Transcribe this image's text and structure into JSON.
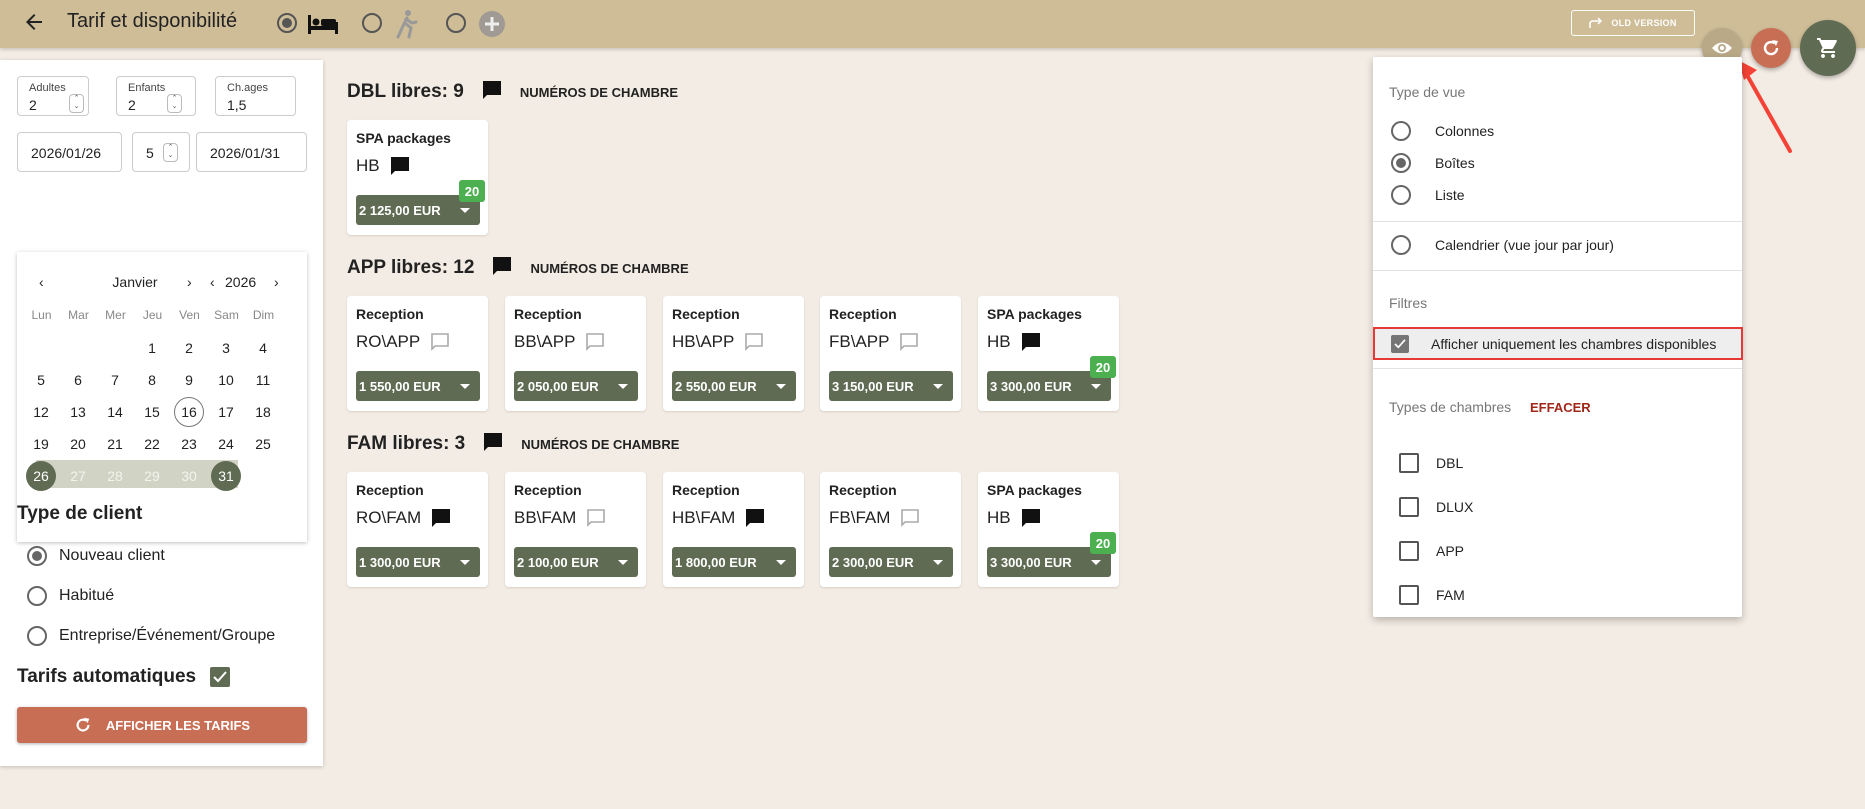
{
  "header": {
    "title": "Tarif et disponibilité",
    "old_version_label": "OLD VERSION",
    "mode_options": [
      {
        "icon": "bed-icon",
        "selected": true
      },
      {
        "icon": "walk-icon",
        "selected": false
      },
      {
        "icon": "plus-icon",
        "selected": false
      }
    ]
  },
  "search": {
    "adults_label": "Adultes",
    "adults_value": "2",
    "children_label": "Enfants",
    "children_value": "2",
    "child_ages_label": "Ch.ages",
    "child_ages_value": "1,5",
    "date_from": "2026/01/26",
    "nights": "5",
    "date_to": "2026/01/31"
  },
  "calendar": {
    "month": "Janvier",
    "year": "2026",
    "weekdays": [
      "Lun",
      "Mar",
      "Mer",
      "Jeu",
      "Ven",
      "Sam",
      "Dim"
    ],
    "weeks": [
      [
        "",
        "",
        "",
        "1",
        "2",
        "3",
        "4"
      ],
      [
        "5",
        "6",
        "7",
        "8",
        "9",
        "10",
        "11"
      ],
      [
        "12",
        "13",
        "14",
        "15",
        "16",
        "17",
        "18"
      ],
      [
        "19",
        "20",
        "21",
        "22",
        "23",
        "24",
        "25"
      ],
      [
        "26",
        "27",
        "28",
        "29",
        "30",
        "31",
        ""
      ]
    ],
    "today": "16",
    "range_start": "26",
    "range_end": "31"
  },
  "client": {
    "heading": "Type de client",
    "options": [
      "Nouveau client",
      "Habitué",
      "Entreprise/Événement/Groupe"
    ],
    "selected_index": 0,
    "auto_rates_label": "Tarifs automatiques",
    "auto_rates_checked": true,
    "show_rates_button": "AFFICHER LES TARIFS"
  },
  "room_numbers_label": "NUMÉROS DE CHAMBRE",
  "room_groups": [
    {
      "title": "DBL libres: 9",
      "cards": [
        {
          "category": "SPA packages",
          "code": "HB",
          "note_filled": true,
          "price": "2 125,00 EUR",
          "badge": "20"
        }
      ]
    },
    {
      "title": "APP libres: 12",
      "cards": [
        {
          "category": "Reception",
          "code": "RO\\APP",
          "note_filled": false,
          "price": "1 550,00 EUR",
          "badge": ""
        },
        {
          "category": "Reception",
          "code": "BB\\APP",
          "note_filled": false,
          "price": "2 050,00 EUR",
          "badge": ""
        },
        {
          "category": "Reception",
          "code": "HB\\APP",
          "note_filled": false,
          "price": "2 550,00 EUR",
          "badge": ""
        },
        {
          "category": "Reception",
          "code": "FB\\APP",
          "note_filled": false,
          "price": "3 150,00 EUR",
          "badge": ""
        },
        {
          "category": "SPA packages",
          "code": "HB",
          "note_filled": true,
          "price": "3 300,00 EUR",
          "badge": "20"
        }
      ]
    },
    {
      "title": "FAM libres: 3",
      "cards": [
        {
          "category": "Reception",
          "code": "RO\\FAM",
          "note_filled": true,
          "price": "1 300,00 EUR",
          "badge": ""
        },
        {
          "category": "Reception",
          "code": "BB\\FAM",
          "note_filled": false,
          "price": "2 100,00 EUR",
          "badge": ""
        },
        {
          "category": "Reception",
          "code": "HB\\FAM",
          "note_filled": true,
          "price": "1 800,00 EUR",
          "badge": ""
        },
        {
          "category": "Reception",
          "code": "FB\\FAM",
          "note_filled": false,
          "price": "2 300,00 EUR",
          "badge": ""
        },
        {
          "category": "SPA packages",
          "code": "HB",
          "note_filled": true,
          "price": "3 300,00 EUR",
          "badge": "20"
        }
      ]
    }
  ],
  "view_panel": {
    "view_type_heading": "Type de vue",
    "view_options": [
      "Colonnes",
      "Boîtes",
      "Liste"
    ],
    "view_selected_index": 1,
    "calendar_option": "Calendrier (vue jour par jour)",
    "filters_heading": "Filtres",
    "filter_available_only": "Afficher uniquement les chambres disponibles",
    "filter_available_checked": true,
    "room_types_heading": "Types de chambres",
    "clear_label": "EFFACER",
    "room_types": [
      "DBL",
      "DLUX",
      "APP",
      "FAM"
    ]
  },
  "colors": {
    "topbar": "#cfbd98",
    "accent_green": "#5f6b52",
    "accent_terracotta": "#c86e55",
    "badge_green": "#4caf50",
    "highlight_red": "#e53935"
  }
}
